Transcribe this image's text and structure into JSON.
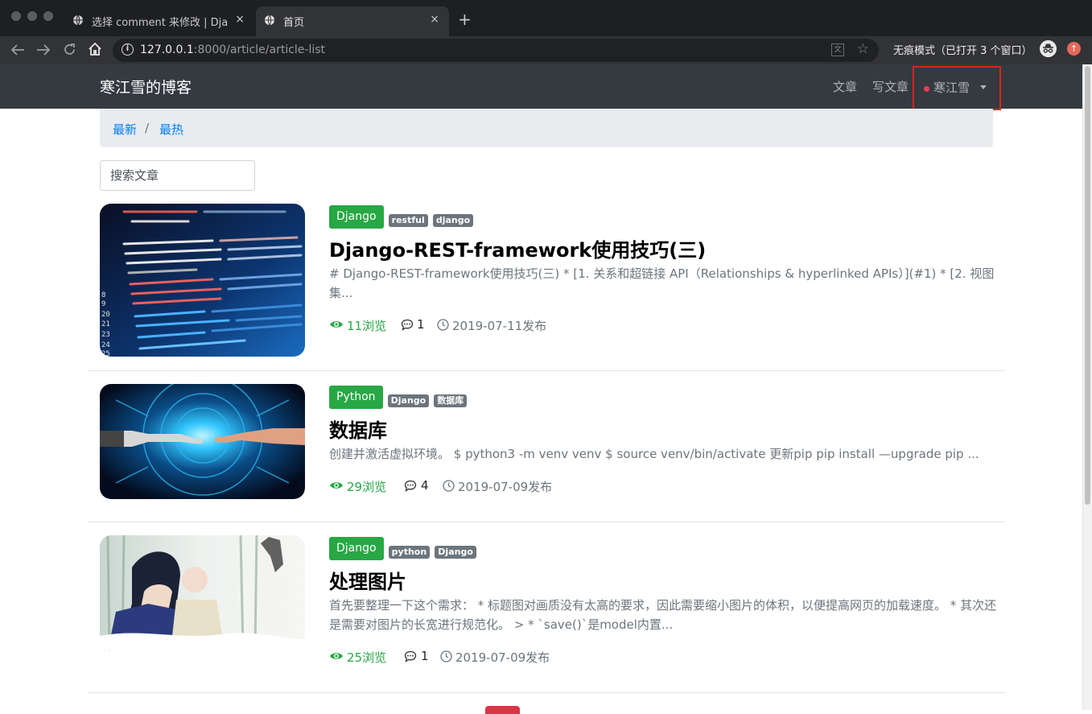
{
  "browser": {
    "tabs": [
      {
        "title": "选择 comment 来修改 | Django",
        "close": "×"
      },
      {
        "title": "首页",
        "close": "×"
      }
    ],
    "new_tab": "+",
    "url_host": "127.0.0.1",
    "url_path": ":8000/article/article-list",
    "info_glyph": "i",
    "incognito_text": "无痕模式（已打开 3 个窗口）",
    "nav_icons": [
      "back-arrow-icon",
      "forward-arrow-icon",
      "reload-icon",
      "home-icon"
    ]
  },
  "site": {
    "brand": "寒江雪的博客",
    "nav": {
      "articles": "文章",
      "write": "写文章",
      "user": "寒江雪"
    },
    "breadcrumb": {
      "latest": "最新",
      "sep": "/",
      "hottest": "最热"
    },
    "search_placeholder": "搜索文章"
  },
  "articles": [
    {
      "column": "Django",
      "column_color": "#28a745",
      "tags": [
        "restful",
        "django"
      ],
      "title": "Django-REST-framework使用技巧(三)",
      "body": "# Django-REST-framework使用技巧(三) * [1. 关系和超链接 API（Relationships & hyperlinked APIs）](#1) * [2. 视图集...",
      "views": "11浏览",
      "comments": "1",
      "date": "2019-07-11发布"
    },
    {
      "column": "Python",
      "column_color": "#28a745",
      "tags": [
        "Django",
        "数据库"
      ],
      "title": "数据库",
      "body": "创建并激活虚拟环境。 $ python3 -m venv venv $ source venv/bin/activate 更新pip pip install —upgrade pip ...",
      "views": "29浏览",
      "comments": "4",
      "date": "2019-07-09发布"
    },
    {
      "column": "Django",
      "column_color": "#28a745",
      "tags": [
        "python",
        "Django"
      ],
      "title": "处理图片",
      "body": "首先要整理一下这个需求： * 标题图对画质没有太高的要求，因此需要缩小图片的体积，以便提高网页的加载速度。 * 其次还是需要对图片的长宽进行规范化。 > * `save()`是model内置...",
      "views": "25浏览",
      "comments": "1",
      "date": "2019-07-09发布"
    }
  ]
}
